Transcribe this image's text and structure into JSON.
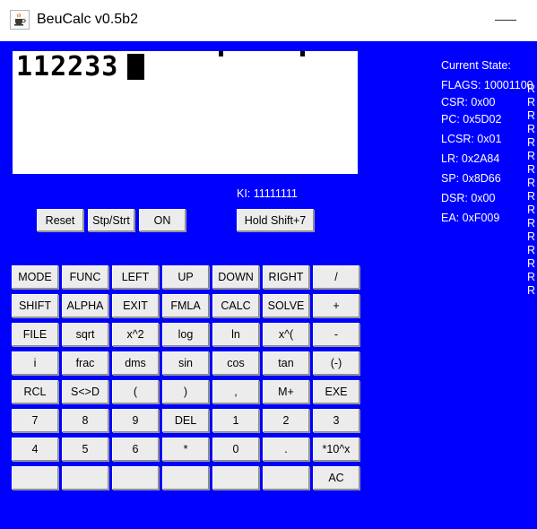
{
  "window": {
    "title": "BeuCalc v0.5b2",
    "icon": "java-coffee-cup-icon",
    "minimize_label": "—",
    "background_color": "#0000ff"
  },
  "display": {
    "text": "112233",
    "cursor": "block",
    "indicators": [
      "",
      ""
    ]
  },
  "state_panel": {
    "heading": "Current State:",
    "lines": [
      {
        "label": "FLAGS",
        "value": "10001100",
        "text": "FLAGS: 10001100"
      },
      {
        "label": "CSR",
        "value": "0x00",
        "text": "CSR: 0x00"
      },
      {
        "label": "PC",
        "value": "0x5D02",
        "text": "PC: 0x5D02"
      },
      {
        "label": "LCSR",
        "value": "0x01",
        "text": "LCSR: 0x01"
      },
      {
        "label": "LR",
        "value": "0x2A84",
        "text": "LR: 0x2A84"
      },
      {
        "label": "SP",
        "value": "0x8D66",
        "text": "SP: 0x8D66"
      },
      {
        "label": "DSR",
        "value": "0x00",
        "text": "DSR: 0x00"
      },
      {
        "label": "EA",
        "value": "0xF009",
        "text": "EA: 0xF009"
      }
    ],
    "registers": [
      "R",
      "R",
      "R",
      "R",
      "R",
      "R",
      "R",
      "R",
      "R",
      "R",
      "R",
      "R",
      "R",
      "R",
      "R",
      "R"
    ]
  },
  "ki": {
    "text": "KI: 11111111"
  },
  "controls": {
    "reset": "Reset",
    "stp_strt": "Stp/Strt",
    "on": "ON",
    "hold_shift": "Hold Shift+7"
  },
  "keypad": {
    "rows": [
      [
        "MODE",
        "FUNC",
        "LEFT",
        "UP",
        "DOWN",
        "RIGHT",
        "/"
      ],
      [
        "SHIFT",
        "ALPHA",
        "EXIT",
        "FMLA",
        "CALC",
        "SOLVE",
        "+"
      ],
      [
        "FILE",
        "sqrt",
        "x^2",
        "log",
        "ln",
        "x^(",
        "-"
      ],
      [
        "i",
        "frac",
        "dms",
        "sin",
        "cos",
        "tan",
        "(-)"
      ],
      [
        "RCL",
        "S<>D",
        "(",
        ")",
        ",",
        "M+",
        "EXE"
      ],
      [
        "7",
        "8",
        "9",
        "DEL",
        "1",
        "2",
        "3"
      ],
      [
        "4",
        "5",
        "6",
        "*",
        "0",
        ".",
        "*10^x"
      ],
      [
        "",
        "",
        "",
        "",
        "",
        "",
        "AC"
      ]
    ]
  }
}
